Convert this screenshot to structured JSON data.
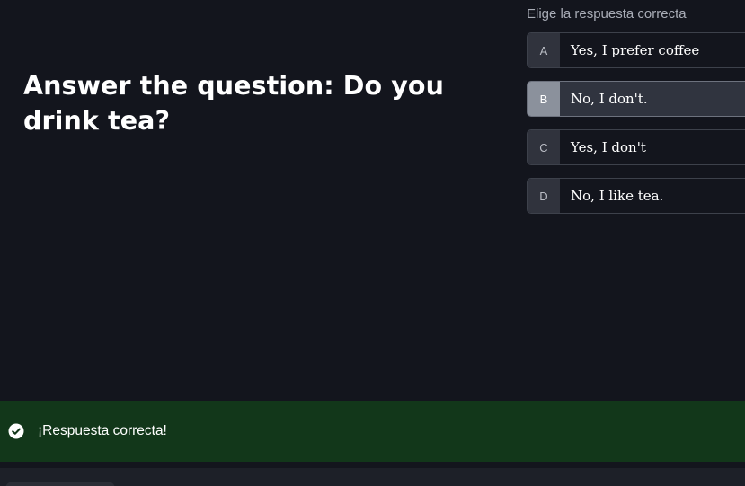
{
  "question": {
    "text": "Answer the question: Do you drink tea?"
  },
  "options_header": "Elige la respuesta correcta",
  "options": [
    {
      "letter": "A",
      "text": "Yes, I prefer coffee",
      "selected": false
    },
    {
      "letter": "B",
      "text": "No, I don't.",
      "selected": true
    },
    {
      "letter": "C",
      "text": "Yes, I don't",
      "selected": false
    },
    {
      "letter": "D",
      "text": "No, I like tea.",
      "selected": false
    }
  ],
  "feedback": {
    "message": "¡Respuesta correcta!",
    "icon": "check-circle-icon",
    "color": "#12371a"
  },
  "colors": {
    "background": "#13151d",
    "selected_option": "#30343f",
    "success": "#12371a"
  }
}
